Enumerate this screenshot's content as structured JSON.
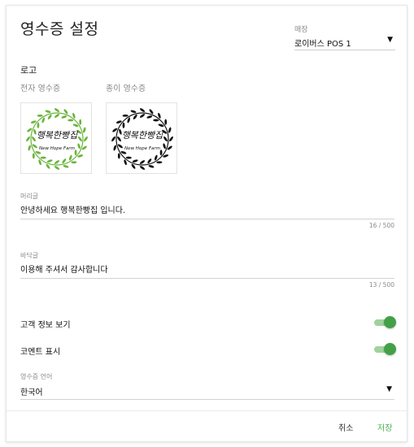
{
  "dialog": {
    "title": "영수증 설정",
    "store": {
      "label": "매장",
      "value": "로이버스 POS 1",
      "arrow": "▼"
    },
    "logo": {
      "heading": "로고",
      "electronic_label": "전자 영수증",
      "paper_label": "종이 영수증",
      "logo_text_korean": "행복한빵집",
      "logo_text_english": "New Hope Farm",
      "electronic_color": "#6ab43a",
      "paper_color": "#111111"
    },
    "header_field": {
      "label": "머리글",
      "value": "안녕하세요 행복한빵집 입니다.",
      "counter": "16 / 500"
    },
    "footer_field": {
      "label": "바닥글",
      "value": "이용해 주셔서 감사합니다",
      "counter": "13 / 500"
    },
    "toggles": [
      {
        "label": "고객 정보 보기",
        "on": true
      },
      {
        "label": "코멘트 표시",
        "on": true
      }
    ],
    "language": {
      "label": "영수증 언어",
      "value": "한국어",
      "arrow": "▼"
    },
    "buttons": {
      "cancel": "취소",
      "save": "저장"
    },
    "colors": {
      "accent": "#4caf50",
      "toggle_knob": "#43a047",
      "toggle_track": "#9fd39c"
    }
  }
}
